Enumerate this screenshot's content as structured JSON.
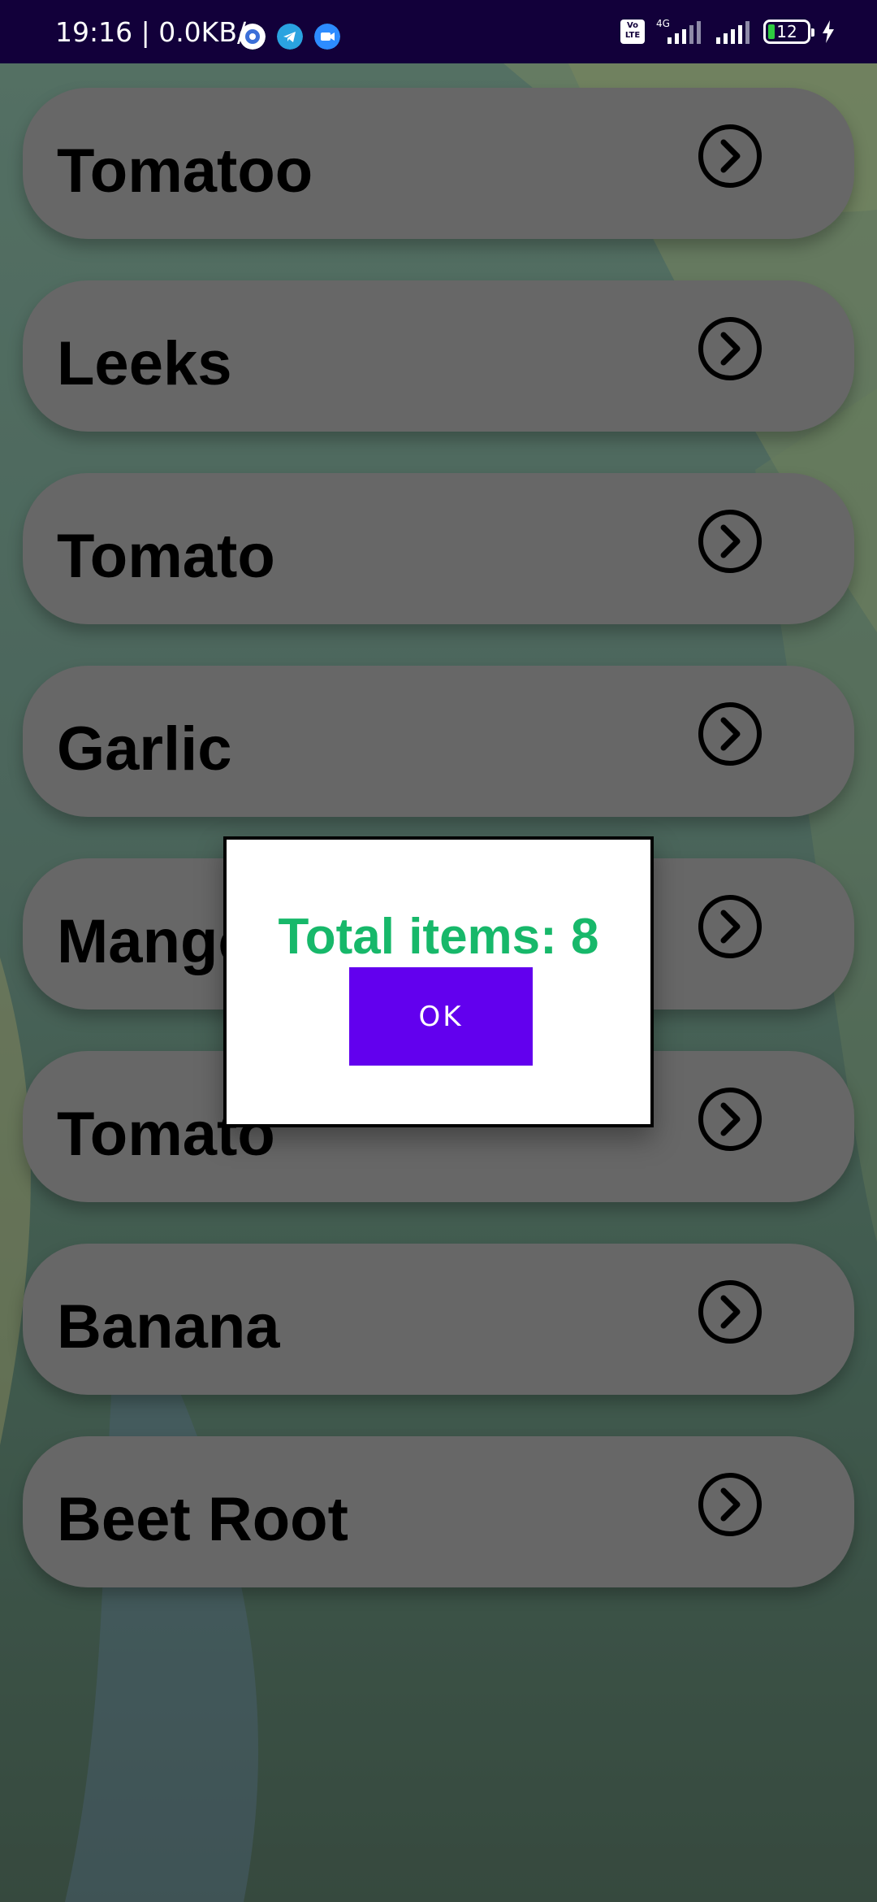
{
  "status_bar": {
    "time": "19:16 | 0.0KB/s",
    "network_label": "4G",
    "volte_label": "Vo LTE",
    "battery_level": "12",
    "app_icons": [
      "settings-app-icon",
      "telegram-icon",
      "video-call-icon"
    ]
  },
  "list": {
    "items": [
      {
        "label": "Tomatoo"
      },
      {
        "label": "Leeks"
      },
      {
        "label": "Tomato"
      },
      {
        "label": "Garlic"
      },
      {
        "label": "Mango"
      },
      {
        "label": "Tomato"
      },
      {
        "label": "Banana"
      },
      {
        "label": "Beet Root"
      }
    ],
    "chevron_icon": "chevron-right-circle-icon"
  },
  "dialog": {
    "title": "Total items: 8",
    "ok_label": "OK"
  },
  "colors": {
    "status_bar": "#12003a",
    "dialog_title": "#17b86a",
    "ok_button": "#6200ee",
    "list_item": "#676767"
  }
}
